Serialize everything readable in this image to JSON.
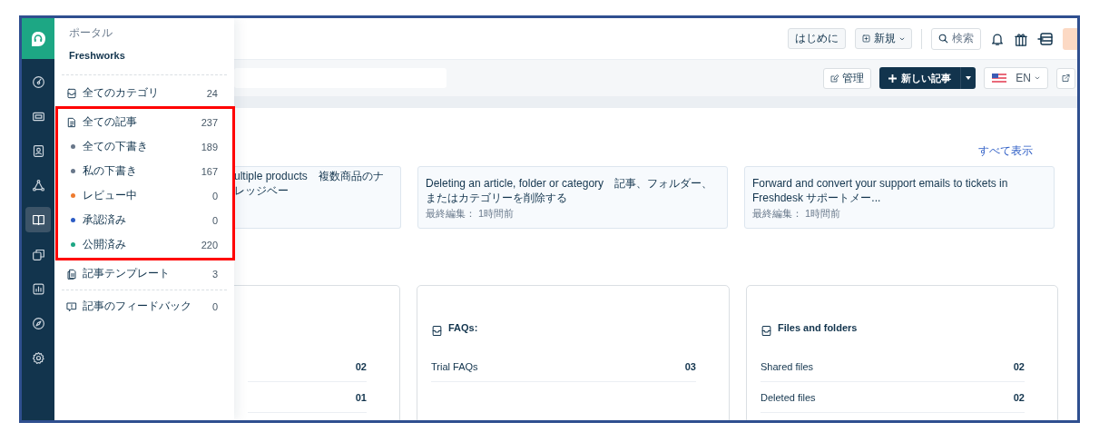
{
  "rail": {
    "items": [
      {
        "selected": false
      },
      {
        "selected": false
      },
      {
        "selected": false
      },
      {
        "selected": false
      },
      {
        "selected": true
      },
      {
        "selected": false
      },
      {
        "selected": false
      },
      {
        "selected": false
      },
      {
        "selected": false
      }
    ]
  },
  "panel": {
    "caption": "ポータル",
    "portal": "Freshworks",
    "items": [
      {
        "label": "全てのカテゴリ",
        "count": "24"
      },
      {
        "label": "全ての記事",
        "count": "237",
        "highlighted": true,
        "children": [
          {
            "label": "全ての下書き",
            "count": "189",
            "color": "#68778a"
          },
          {
            "label": "私の下書き",
            "count": "167",
            "color": "#68778a"
          },
          {
            "label": "レビュー中",
            "count": "0",
            "color": "#ee7b2f"
          },
          {
            "label": "承認済み",
            "count": "0",
            "color": "#2c5cc5"
          },
          {
            "label": "公開済み",
            "count": "220",
            "color": "#1da784"
          }
        ]
      },
      {
        "label": "記事テンプレート",
        "count": "3"
      },
      {
        "label": "記事のフィードバック",
        "count": "0"
      }
    ]
  },
  "top_bar": {
    "buttons": [
      "はじめに",
      "新規"
    ],
    "search": {
      "placeholder": "検索"
    }
  },
  "sub_bar": {
    "manage": "管理",
    "new_article": "新しい記事",
    "language": "EN"
  },
  "recent": {
    "view_all": "すべて表示",
    "cards": [
      {
        "title": "ultiple products　複数商品のナレッジベー"
      },
      {
        "title": "Deleting an article, folder or category　記事、フォルダー、またはカテゴリーを削除する",
        "meta": "最終編集： 1時間前"
      },
      {
        "title": "Forward and convert your support emails to tickets in Freshdesk サポートメー...",
        "meta": "最終編集： 1時間前"
      }
    ]
  },
  "sections": [
    {
      "rows": [
        {
          "count": "02"
        },
        {
          "count": "01"
        }
      ]
    },
    {
      "title": "FAQs:",
      "rows": [
        {
          "label": "Trial FAQs",
          "count": "03"
        }
      ]
    },
    {
      "title": "Files and folders",
      "rows": [
        {
          "label": "Shared files",
          "count": "02"
        },
        {
          "label": "Deleted files",
          "count": "02"
        }
      ]
    }
  ]
}
